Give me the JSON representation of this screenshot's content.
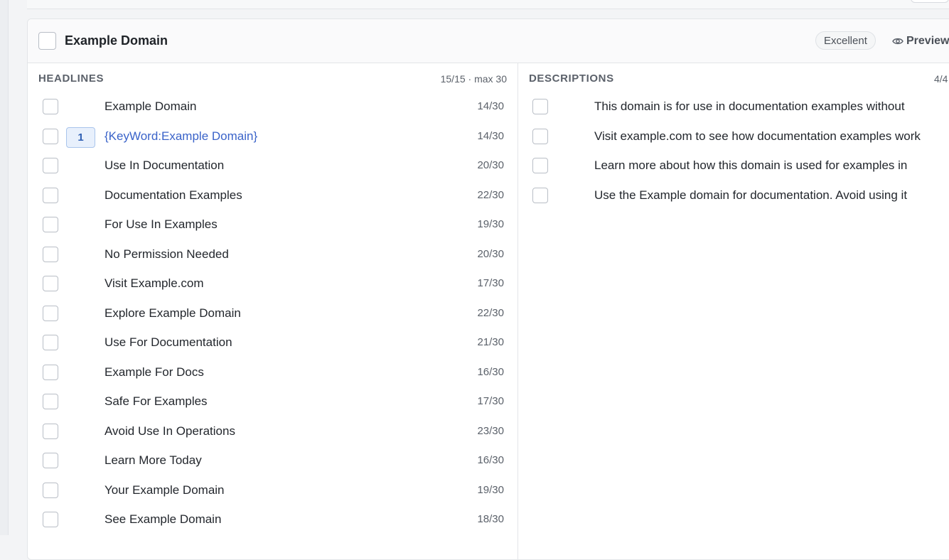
{
  "card": {
    "title": "Example Domain",
    "quality_badge": "Excellent",
    "preview_label": "Preview"
  },
  "headlines": {
    "title": "HEADLINES",
    "count": "15/15 · max 30",
    "items": [
      {
        "text": "Example Domain",
        "count": "14/30"
      },
      {
        "text": "{KeyWord:Example Domain}",
        "count": "14/30",
        "pin": "1"
      },
      {
        "text": "Use In Documentation",
        "count": "20/30"
      },
      {
        "text": "Documentation Examples",
        "count": "22/30"
      },
      {
        "text": "For Use In Examples",
        "count": "19/30"
      },
      {
        "text": "No Permission Needed",
        "count": "20/30"
      },
      {
        "text": "Visit Example.com",
        "count": "17/30"
      },
      {
        "text": "Explore Example Domain",
        "count": "22/30"
      },
      {
        "text": "Use For Documentation",
        "count": "21/30"
      },
      {
        "text": "Example For Docs",
        "count": "16/30"
      },
      {
        "text": "Safe For Examples",
        "count": "17/30"
      },
      {
        "text": "Avoid Use In Operations",
        "count": "23/30"
      },
      {
        "text": "Learn More Today",
        "count": "16/30"
      },
      {
        "text": "Your Example Domain",
        "count": "19/30"
      },
      {
        "text": "See Example Domain",
        "count": "18/30"
      }
    ]
  },
  "descriptions": {
    "title": "DESCRIPTIONS",
    "count": "4/4",
    "items": [
      {
        "text": "This domain is for use in documentation examples without"
      },
      {
        "text": "Visit example.com to see how documentation examples work"
      },
      {
        "text": "Learn more about how this domain is used for examples in"
      },
      {
        "text": "Use the Example domain for documentation. Avoid using it"
      }
    ]
  },
  "colors": {
    "keyword_text": "#3a63c9",
    "pin_bg": "#e8f0fc",
    "pin_border": "#a9c4ec"
  },
  "icons": {
    "preview": "eye-icon"
  }
}
